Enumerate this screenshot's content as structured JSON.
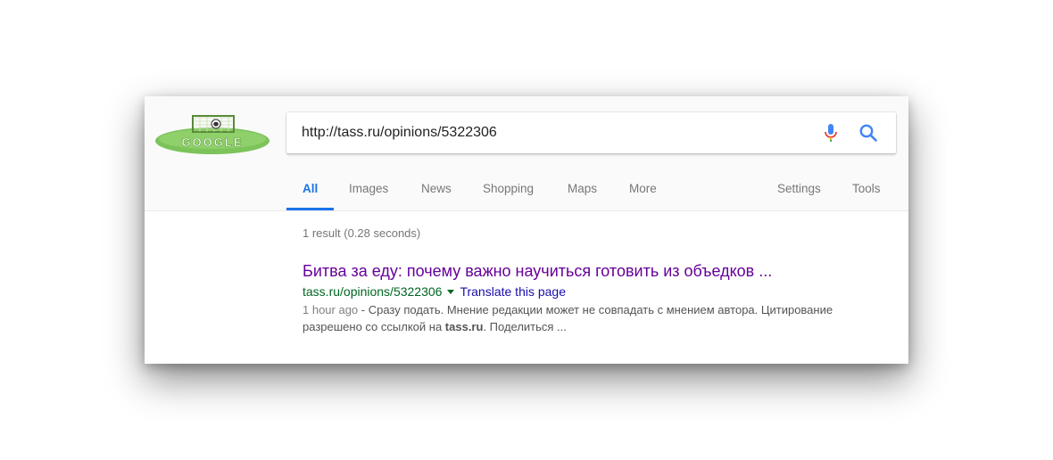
{
  "search": {
    "query": "http://tass.ru/opinions/5322306"
  },
  "logo": {
    "text": "GOOGLE"
  },
  "tabs": [
    {
      "label": "All",
      "active": true
    },
    {
      "label": "Images"
    },
    {
      "label": "News"
    },
    {
      "label": "Shopping"
    },
    {
      "label": "Maps"
    },
    {
      "label": "More"
    },
    {
      "label": "Settings"
    },
    {
      "label": "Tools"
    }
  ],
  "results_stats": "1 result (0.28 seconds)",
  "result": {
    "title": "Битва за еду: почему важно научиться готовить из объедков ...",
    "url": "tass.ru/opinions/5322306",
    "translate": "Translate this page",
    "date": "1 hour ago",
    "snippet_part1": " - Сразу подать. Мнение редакции может не совпадать с мнением автора. Цитирование разрешено со ссылкой на ",
    "snippet_bold": "tass.ru",
    "snippet_part2": ". Поделиться ..."
  },
  "colors": {
    "accent": "#1a73e8",
    "title_visited": "#660099",
    "url_green": "#006621",
    "link_blue": "#1a0dab"
  },
  "icons": {
    "mic": "microphone-icon",
    "search": "search-icon"
  }
}
